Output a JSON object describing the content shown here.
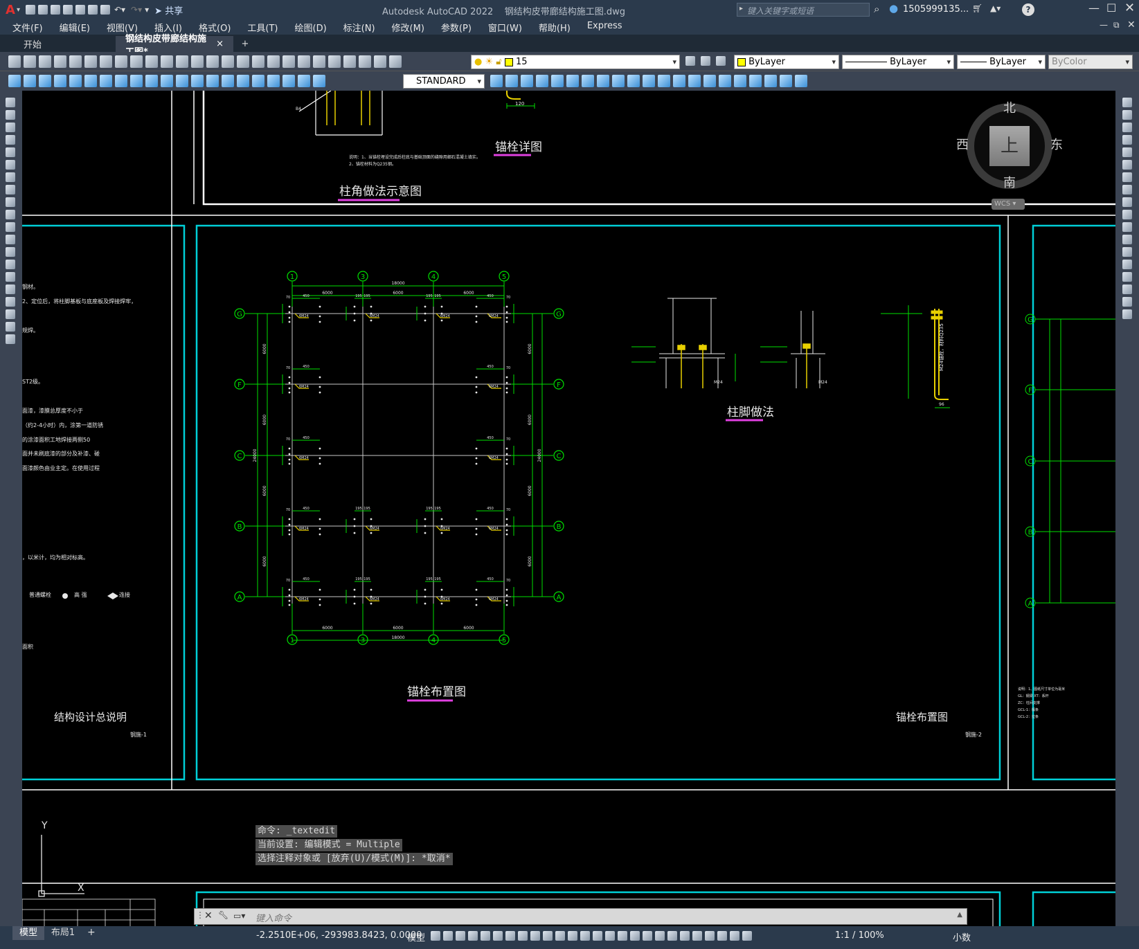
{
  "titlebar": {
    "app_logo": "A",
    "share_label": "共享",
    "app_title": "Autodesk AutoCAD 2022",
    "document_title": "钢结构皮带廊结构施工图.dwg",
    "search_placeholder": "键入关键字或短语",
    "user_name": "1505999135...",
    "icon": "autocad-logo-icon"
  },
  "menubar": {
    "items": [
      "文件(F)",
      "编辑(E)",
      "视图(V)",
      "插入(I)",
      "格式(O)",
      "工具(T)",
      "绘图(D)",
      "标注(N)",
      "修改(M)",
      "参数(P)",
      "窗口(W)",
      "帮助(H)",
      "Express"
    ]
  },
  "tabs": {
    "start": "开始",
    "active": "钢结构皮带廊结构施工图*",
    "close_glyph": "×",
    "new_glyph": "+"
  },
  "toolbar": {
    "layer_value": "15",
    "color_value": "ByLayer",
    "linetype_value": "ByLayer",
    "lineweight_value": "ByLayer",
    "plotstyle_value": "ByColor",
    "textstyle_value": "STANDARD"
  },
  "viewcube": {
    "north": "北",
    "south": "南",
    "east": "东",
    "west": "西",
    "face": "上",
    "wcs": "WCS"
  },
  "drawing": {
    "col_labels": [
      "1",
      "3",
      "4",
      "5"
    ],
    "row_labels": [
      "G",
      "F",
      "C",
      "B",
      "A"
    ],
    "right_row_labels": [
      "G",
      "F",
      "C",
      "B",
      "A"
    ],
    "dim_total": "18000",
    "dim_span": "6000",
    "dim_total_v": "24000",
    "dim_450": "450",
    "dim_70": "70",
    "dim_195": "195",
    "dim_120": "120",
    "dim_96": "96",
    "anchor_label": "6M24",
    "section_text": "M24",
    "bolt_label": "M24锚栓，材料Q235",
    "titles": {
      "column_base_sketch": "柱角做法示意图",
      "anchor_detail": "锚栓详图",
      "column_foot": "柱脚做法",
      "anchor_layout": "锚栓布置图",
      "sheet_left_title": "结构设计总说明",
      "sheet_left_no": "钢施-1",
      "sheet_mid_title": "锚栓布置图",
      "sheet_mid_no": "钢施-2"
    },
    "notes_left": [
      "钢材。",
      "2、定位后，将柱脚基板与底座板及焊接焊牢，",
      "规焊。",
      "ST2级。",
      "面漆，漆膜总厚度不小于",
      "（约2-4小时）内，涂第一道防锈",
      "的涂漆面积工地焊接两侧50",
      "面并未刷底漆的部分及补漆、碰",
      "面漆颜色由业主定。在使用过程",
      "，以米计，均为相对标高。",
      "普通螺栓",
      "高 强",
      "连接",
      "面积"
    ],
    "notes_small": "说明：1、当锚栓埋设完成后柱底与基础顶面的缝隙用细石混凝土填实。",
    "notes_small2": "2、锚栓材料为Q235钢。",
    "right_notes": [
      "说明：1、图纸尺寸单位为毫米",
      "GL：钢梁 XT：系杆",
      "ZC：柱间支撑",
      "GCL-1：檩条",
      "GCL-2：拉条"
    ]
  },
  "command": {
    "history": [
      "命令: _textedit",
      "当前设置: 编辑模式 = Multiple",
      "选择注释对象或 [放弃(U)/模式(M)]: *取消*"
    ],
    "placeholder": "键入命令"
  },
  "statusbar": {
    "model_tab": "模型",
    "layout_tab": "布局1",
    "add_glyph": "+",
    "coords": "-2.2510E+06, -293983.8423, 0.0000",
    "mode": "模型",
    "scale": "1:1 / 100%",
    "units": "小数"
  },
  "colors": {
    "frame": "#00d7d7",
    "grid": "#00e000",
    "annot": "#e8e8e8",
    "accent_magenta": "#e040e0",
    "bolt_yellow": "#e8d000",
    "chrome": "#2b3a4c",
    "toolbar": "#3b4453"
  }
}
